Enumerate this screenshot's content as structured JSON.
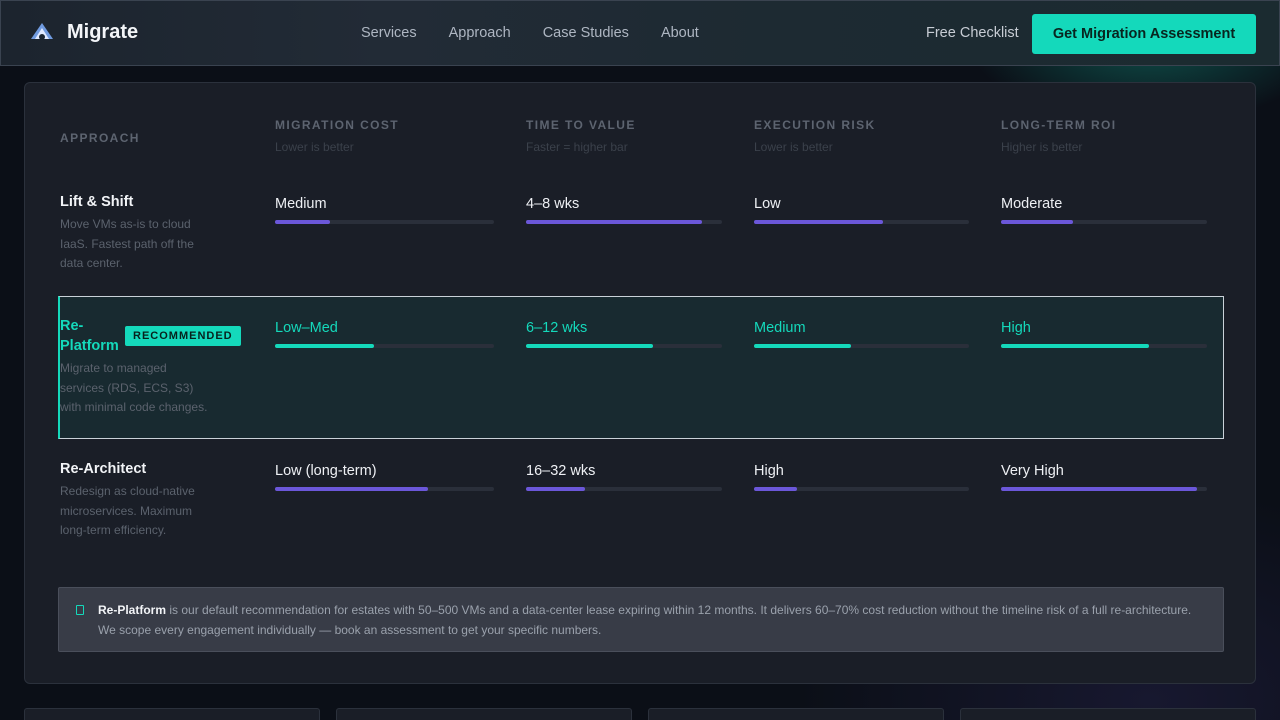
{
  "header": {
    "brand": "Migrate",
    "nav": [
      "Services",
      "Approach",
      "Case Studies",
      "About"
    ],
    "checklist": "Free Checklist",
    "cta": "Get Migration Assessment"
  },
  "table": {
    "approach_header": "APPROACH",
    "columns": [
      {
        "title": "MIGRATION COST",
        "sub": "Lower is better"
      },
      {
        "title": "TIME TO VALUE",
        "sub": "Faster = higher bar"
      },
      {
        "title": "EXECUTION RISK",
        "sub": "Lower is better"
      },
      {
        "title": "LONG-TERM ROI",
        "sub": "Higher is better"
      }
    ],
    "rows": [
      {
        "name": "Lift & Shift",
        "desc": "Move VMs as-is to cloud IaaS. Fastest path off the data center.",
        "values": [
          "Medium",
          "4–8 wks",
          "Low",
          "Moderate"
        ],
        "levels": [
          0.25,
          0.9,
          0.6,
          0.35
        ]
      },
      {
        "name": "Re-Platform",
        "badge": "RECOMMENDED",
        "desc": "Migrate to managed services (RDS, ECS, S3) with minimal code changes.",
        "values": [
          "Low–Med",
          "6–12 wks",
          "Medium",
          "High"
        ],
        "levels": [
          0.45,
          0.65,
          0.45,
          0.72
        ]
      },
      {
        "name": "Re-Architect",
        "desc": "Redesign as cloud-native microservices. Maximum long-term efficiency.",
        "values": [
          "Low (long-term)",
          "16–32 wks",
          "High",
          "Very High"
        ],
        "levels": [
          0.7,
          0.3,
          0.2,
          0.95
        ]
      }
    ]
  },
  "note": {
    "bold": "Re-Platform",
    "text": " is our default recommendation for estates with 50–500 VMs and a data-center lease expiring within 12 months. It delivers 60–70% cost reduction without the timeline risk of a full re-architecture. We scope every engagement individually — book an assessment to get your specific numbers."
  },
  "colors": {
    "accent": "#14d9bb",
    "bar": "#6b57d9"
  }
}
